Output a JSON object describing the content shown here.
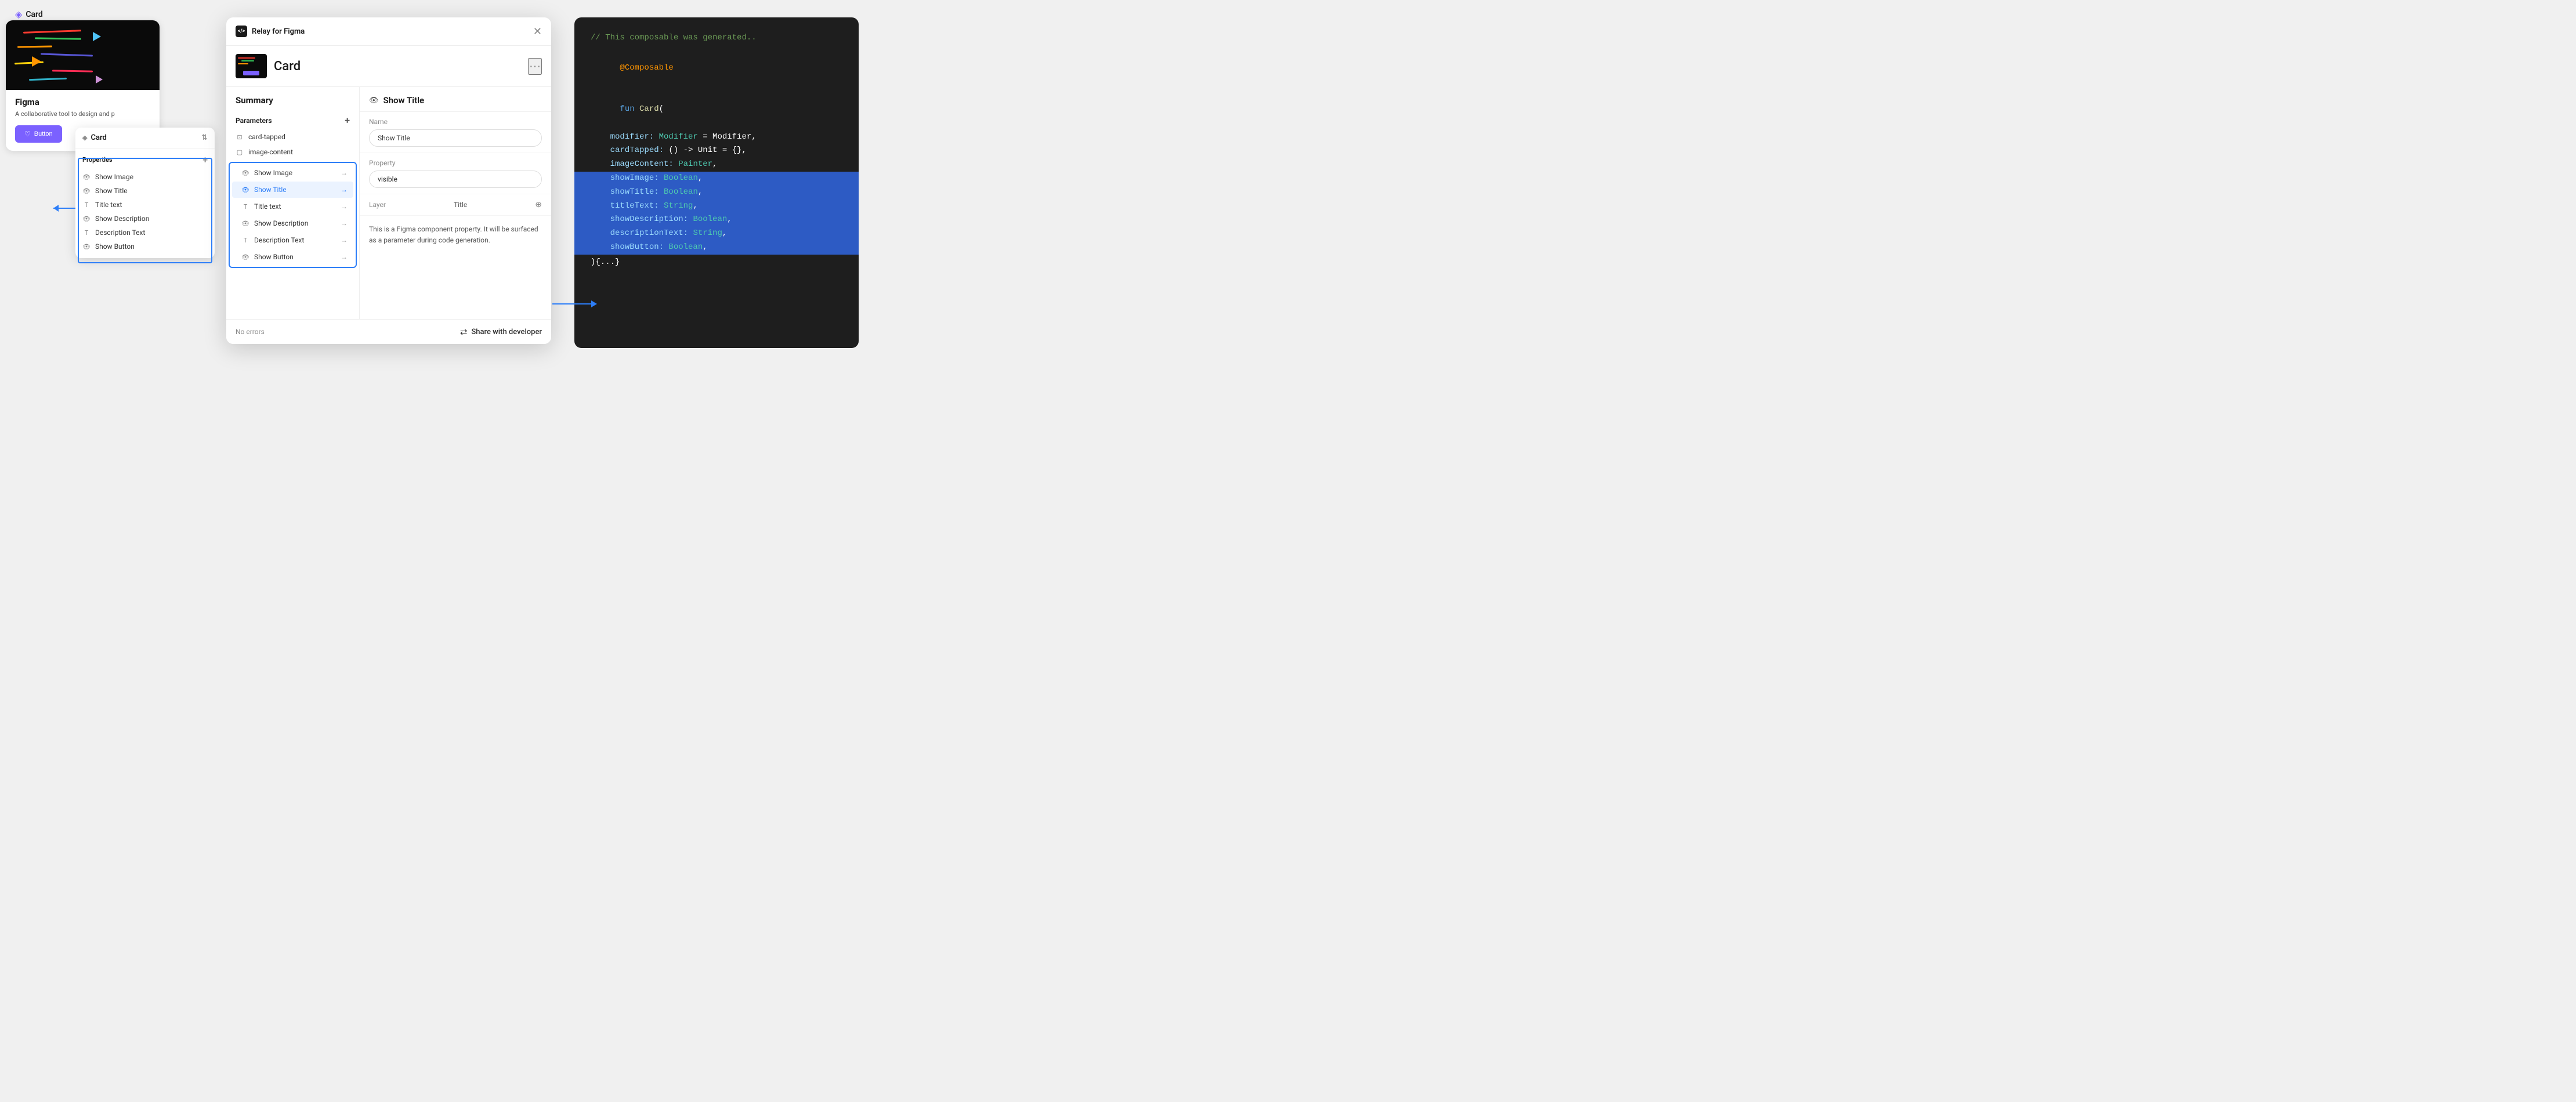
{
  "app": {
    "title": "Card",
    "header_icon": "◈"
  },
  "figma_preview": {
    "title": "Figma",
    "description": "A collaborative tool to design and p",
    "button_label": "Button"
  },
  "properties_panel": {
    "title": "Card",
    "section_label": "Properties",
    "items": [
      {
        "icon": "👁",
        "label": "Show Image",
        "type": "visibility"
      },
      {
        "icon": "👁",
        "label": "Show Title",
        "type": "visibility"
      },
      {
        "icon": "T",
        "label": "Title text",
        "type": "text"
      },
      {
        "icon": "👁",
        "label": "Show Description",
        "type": "visibility"
      },
      {
        "icon": "T",
        "label": "Description Text",
        "type": "text"
      },
      {
        "icon": "👁",
        "label": "Show Button",
        "type": "visibility"
      }
    ]
  },
  "relay_dialog": {
    "brand": "Relay for Figma",
    "card_name": "Card",
    "summary_label": "Summary",
    "parameters_label": "Parameters",
    "params": [
      {
        "icon": "tap",
        "label": "card-tapped"
      },
      {
        "icon": "image",
        "label": "image-content"
      }
    ],
    "properties": [
      {
        "icon": "eye",
        "label": "Show Image",
        "selected": false
      },
      {
        "icon": "eye",
        "label": "Show Title",
        "selected": true
      },
      {
        "icon": "T",
        "label": "Title text",
        "selected": false
      },
      {
        "icon": "eye",
        "label": "Show Description",
        "selected": false
      },
      {
        "icon": "T",
        "label": "Description Text",
        "selected": false
      },
      {
        "icon": "eye",
        "label": "Show Button",
        "selected": false
      }
    ],
    "detail_title": "Show Title",
    "name_label": "Name",
    "name_value": "Show Title",
    "property_label": "Property",
    "property_value": "visible",
    "layer_label": "Layer",
    "layer_value": "Title",
    "description": "This is a Figma component property. It will be surfaced as a parameter during code generation.",
    "footer_status": "No errors",
    "share_label": "Share with developer"
  },
  "code_panel": {
    "comment": "// This composable was generated..",
    "annotation": "@Composable",
    "fun_keyword": "fun",
    "card_name": "Card(",
    "lines": [
      {
        "text": "    modifier: Modifier = Modifier,",
        "highlighted": false
      },
      {
        "text": "    cardTapped: () -> Unit = {},",
        "highlighted": false
      },
      {
        "text": "    imageContent: Painter,",
        "highlighted": false
      },
      {
        "text": "    showImage: Boolean,",
        "highlighted": true
      },
      {
        "text": "    showTitle: Boolean,",
        "highlighted": true
      },
      {
        "text": "    titleText: String,",
        "highlighted": true
      },
      {
        "text": "    showDescription: Boolean,",
        "highlighted": true
      },
      {
        "text": "    descriptionText: String,",
        "highlighted": true
      },
      {
        "text": "    showButton: Boolean,",
        "highlighted": true
      }
    ],
    "closing": "){...}"
  }
}
